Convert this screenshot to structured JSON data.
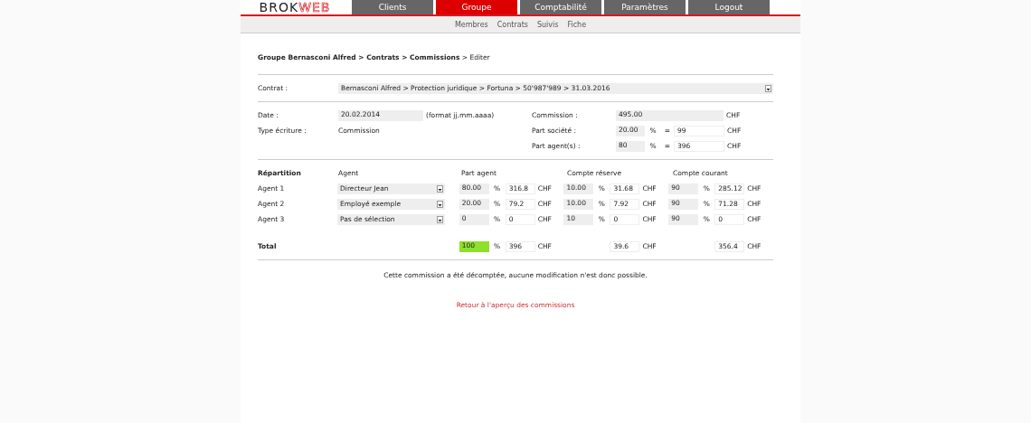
{
  "logo": {
    "part_1": "BROK",
    "part_2": "WEB"
  },
  "main_tabs": [
    {
      "label": "Clients",
      "selected": false
    },
    {
      "label": "Groupe",
      "selected": true
    },
    {
      "label": "Comptabilité",
      "selected": false
    },
    {
      "label": "Paramètres",
      "selected": false
    },
    {
      "label": "Logout",
      "selected": false
    }
  ],
  "sub_nav": [
    "Membres",
    "Contrats",
    "Suivis",
    "Fiche"
  ],
  "breadcrumb": "**Groupe Bernasconi Alfred > Contrats > Commissions** > Editer",
  "contract": {
    "label": "Contrat :",
    "value": "Bernasconi Alfred > Protection juridique > Fortuna > 50'987'989 > 31.03.2016"
  },
  "details_left": [
    {
      "kind": "input",
      "label": "Date :",
      "value": "20.02.2014",
      "hint": "(format jj.mm.aaaa)"
    },
    {
      "kind": "text",
      "label": "Type écriture :",
      "value": "Commission"
    }
  ],
  "details_right": [
    {
      "kind": "amount",
      "label": "Commission :",
      "value": "495.00",
      "currency": "CHF"
    },
    {
      "kind": "split",
      "label": "Part société :",
      "percent": "20.00",
      "unit": "%",
      "equals": "=",
      "amount": "99",
      "currency": "CHF"
    },
    {
      "kind": "split",
      "label": "Part agent(s) :",
      "percent": "80",
      "unit": "%",
      "equals": "=",
      "amount": "396",
      "currency": "CHF"
    }
  ],
  "distribution": {
    "headers": [
      "Répartition",
      "Agent",
      "Part agent",
      "Compte réserve",
      "Compte courant"
    ],
    "rows": [
      {
        "label": "Agent 1",
        "agent": "Directeur Jean",
        "part": {
          "percent": "80.00",
          "unit": "%",
          "amount": "316.8",
          "currency": "CHF"
        },
        "reserve": {
          "percent": "10.00",
          "unit": "%",
          "amount": "31.68",
          "currency": "CHF"
        },
        "current": {
          "percent": "90",
          "unit": "%",
          "amount": "285.12",
          "currency": "CHF"
        }
      },
      {
        "label": "Agent 2",
        "agent": "Employé exemple",
        "part": {
          "percent": "20.00",
          "unit": "%",
          "amount": "79.2",
          "currency": "CHF"
        },
        "reserve": {
          "percent": "10.00",
          "unit": "%",
          "amount": "7.92",
          "currency": "CHF"
        },
        "current": {
          "percent": "90",
          "unit": "%",
          "amount": "71.28",
          "currency": "CHF"
        }
      },
      {
        "label": "Agent 3",
        "agent": "Pas de sélection",
        "part": {
          "percent": "0",
          "unit": "%",
          "amount": "0",
          "currency": "CHF"
        },
        "reserve": {
          "percent": "10",
          "unit": "%",
          "amount": "0",
          "currency": "CHF"
        },
        "current": {
          "percent": "90",
          "unit": "%",
          "amount": "0",
          "currency": "CHF"
        }
      }
    ],
    "total": {
      "label": "Total",
      "part": {
        "percent": "100",
        "valid": true,
        "unit": "%",
        "amount": "396",
        "currency": "CHF"
      },
      "reserve": {
        "amount": "39.6",
        "currency": "CHF"
      },
      "current": {
        "amount": "356.4",
        "currency": "CHF"
      }
    }
  },
  "notice": "Cette commission a été décomptée, aucune modification n'est donc possible.",
  "back_link": "Retour à l'aperçu des commissions"
}
